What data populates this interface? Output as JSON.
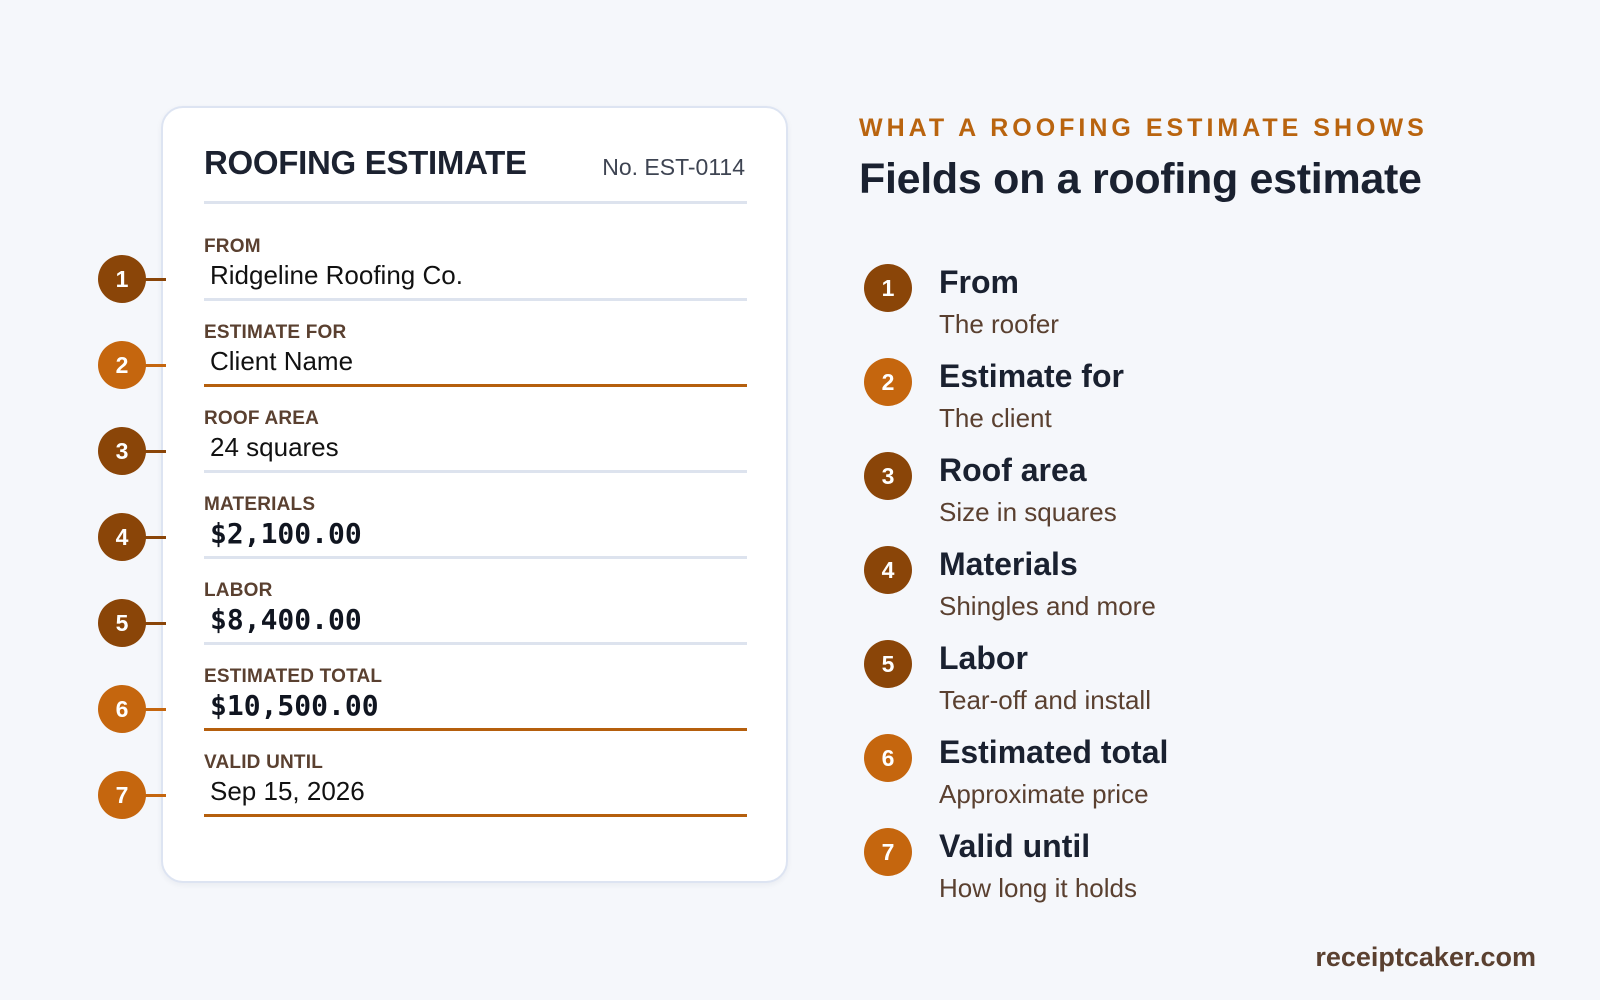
{
  "estimate": {
    "title": "ROOFING ESTIMATE",
    "number": "No. EST-0114",
    "fields": [
      {
        "n": "1",
        "label": "FROM",
        "value": "Ridgeline Roofing Co."
      },
      {
        "n": "2",
        "label": "ESTIMATE FOR",
        "value": "Client Name"
      },
      {
        "n": "3",
        "label": "ROOF AREA",
        "value": "24 squares"
      },
      {
        "n": "4",
        "label": "MATERIALS",
        "value": "$2,100.00"
      },
      {
        "n": "5",
        "label": "LABOR",
        "value": "$8,400.00"
      },
      {
        "n": "6",
        "label": "ESTIMATED TOTAL",
        "value": "$10,500.00"
      },
      {
        "n": "7",
        "label": "VALID UNTIL",
        "value": "Sep 15, 2026"
      }
    ]
  },
  "legend": {
    "eyebrow": "WHAT A ROOFING ESTIMATE SHOWS",
    "heading": "Fields on a roofing estimate",
    "items": [
      {
        "n": "1",
        "title": "From",
        "desc": "The roofer"
      },
      {
        "n": "2",
        "title": "Estimate for",
        "desc": "The client"
      },
      {
        "n": "3",
        "title": "Roof area",
        "desc": "Size in squares"
      },
      {
        "n": "4",
        "title": "Materials",
        "desc": "Shingles and more"
      },
      {
        "n": "5",
        "title": "Labor",
        "desc": "Tear-off and install"
      },
      {
        "n": "6",
        "title": "Estimated total",
        "desc": "Approximate price"
      },
      {
        "n": "7",
        "title": "Valid until",
        "desc": "How long it holds"
      }
    ]
  },
  "footer": {
    "site": "receiptcaker.com"
  },
  "colors": {
    "accent_dark": "#8a4508",
    "accent_orange": "#c5660e",
    "underline_highlight": "#b55f0d"
  }
}
